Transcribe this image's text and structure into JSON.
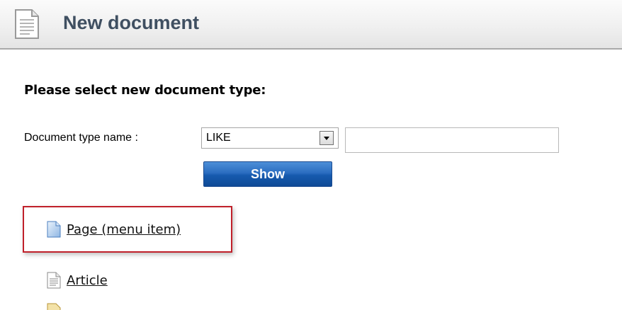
{
  "header": {
    "title": "New document",
    "icon": "document-icon"
  },
  "main": {
    "heading": "Please select new document type:",
    "filter": {
      "label": "Document type name :",
      "operator_selected": "LIKE",
      "text_value": "",
      "show_label": "Show"
    },
    "document_types": [
      {
        "label": "Page (menu item)",
        "icon": "page-icon",
        "highlighted": true
      },
      {
        "label": "Article",
        "icon": "article-icon",
        "highlighted": false
      }
    ],
    "highlight_color": "#c0202a"
  }
}
